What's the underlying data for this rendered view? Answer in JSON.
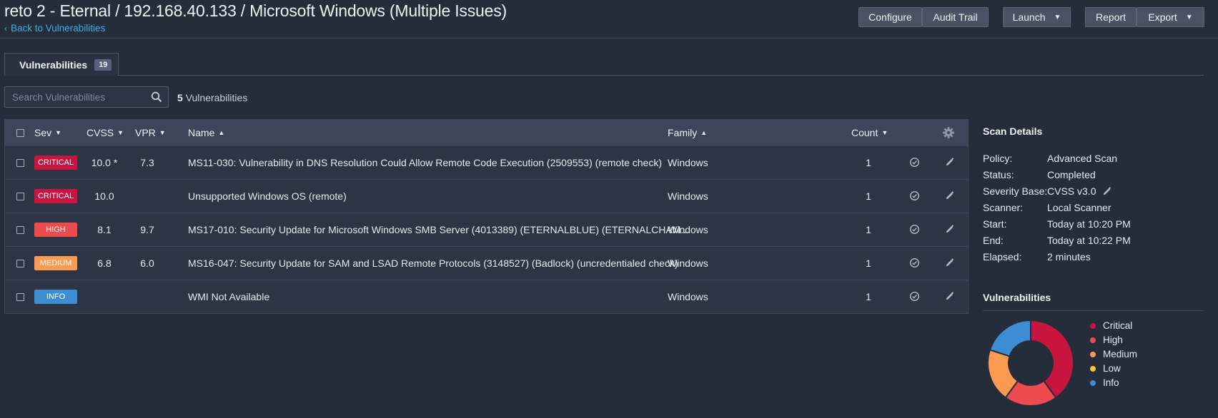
{
  "header": {
    "title": "reto 2 - Eternal / 192.168.40.133 / Microsoft Windows (Multiple Issues)",
    "back_label": "Back to Vulnerabilities",
    "buttons": {
      "configure": "Configure",
      "audit_trail": "Audit Trail",
      "launch": "Launch",
      "report": "Report",
      "export": "Export"
    }
  },
  "tabs": [
    {
      "label": "Vulnerabilities",
      "count": "19"
    }
  ],
  "search": {
    "placeholder": "Search Vulnerabilities",
    "value": "",
    "count_num": "5",
    "count_label": "Vulnerabilities"
  },
  "table": {
    "columns": {
      "sev": "Sev",
      "cvss": "CVSS",
      "vpr": "VPR",
      "name": "Name",
      "family": "Family",
      "count": "Count"
    },
    "rows": [
      {
        "sev": "CRITICAL",
        "sev_color": "#c8153f",
        "cvss": "10.0 *",
        "vpr": "7.3",
        "name": "MS11-030: Vulnerability in DNS Resolution Could Allow Remote Code Execution (2509553) (remote check)",
        "family": "Windows",
        "count": "1"
      },
      {
        "sev": "CRITICAL",
        "sev_color": "#c8153f",
        "cvss": "10.0",
        "vpr": "",
        "name": "Unsupported Windows OS (remote)",
        "family": "Windows",
        "count": "1"
      },
      {
        "sev": "HIGH",
        "sev_color": "#ee4b4f",
        "cvss": "8.1",
        "vpr": "9.7",
        "name": "MS17-010: Security Update for Microsoft Windows SMB Server (4013389) (ETERNALBLUE) (ETERNALCHAM...",
        "family": "Windows",
        "count": "1"
      },
      {
        "sev": "MEDIUM",
        "sev_color": "#fb9b52",
        "cvss": "6.8",
        "vpr": "6.0",
        "name": "MS16-047: Security Update for SAM and LSAD Remote Protocols (3148527) (Badlock) (uncredentialed check)",
        "family": "Windows",
        "count": "1"
      },
      {
        "sev": "INFO",
        "sev_color": "#3e8cd2",
        "cvss": "",
        "vpr": "",
        "name": "WMI Not Available",
        "family": "Windows",
        "count": "1"
      }
    ]
  },
  "scan_details": {
    "title": "Scan Details",
    "items": [
      {
        "label": "Policy:",
        "value": "Advanced Scan"
      },
      {
        "label": "Status:",
        "value": "Completed"
      },
      {
        "label": "Severity Base:",
        "value": "CVSS v3.0"
      },
      {
        "label": "Scanner:",
        "value": "Local Scanner"
      },
      {
        "label": "Start:",
        "value": "Today at 10:20 PM"
      },
      {
        "label": "End:",
        "value": "Today at 10:22 PM"
      },
      {
        "label": "Elapsed:",
        "value": "2 minutes"
      }
    ]
  },
  "vuln_chart": {
    "title": "Vulnerabilities",
    "legend": [
      {
        "label": "Critical",
        "color": "#c8153f",
        "value": 2
      },
      {
        "label": "High",
        "color": "#ee4b4f",
        "value": 1
      },
      {
        "label": "Medium",
        "color": "#fb9b52",
        "value": 1
      },
      {
        "label": "Low",
        "color": "#fdc431",
        "value": 0
      },
      {
        "label": "Info",
        "color": "#3e8cd2",
        "value": 1
      }
    ]
  }
}
